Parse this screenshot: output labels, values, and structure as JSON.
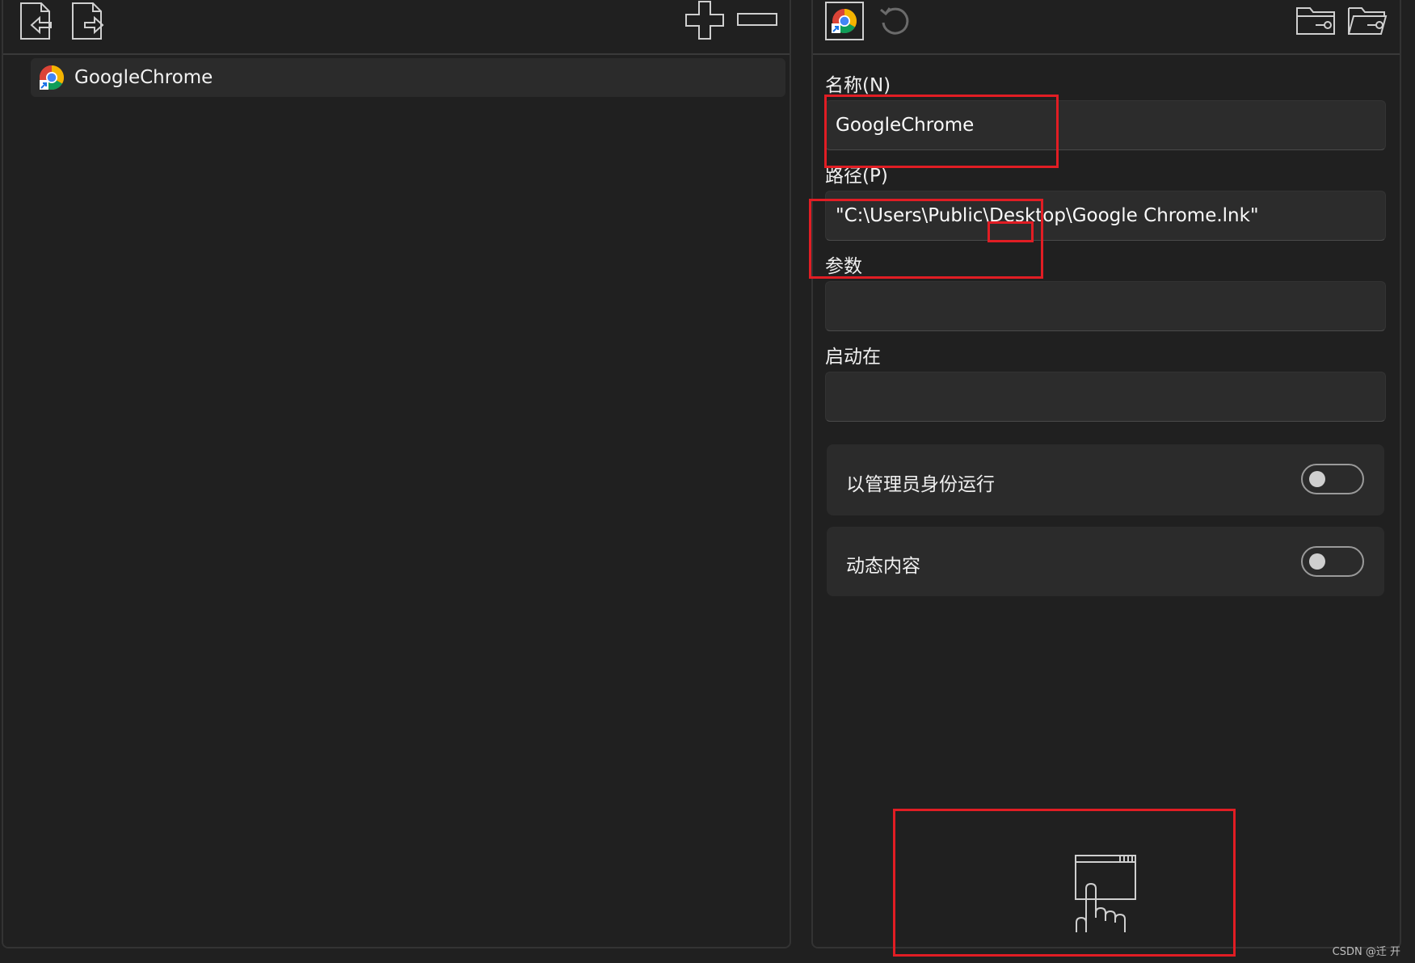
{
  "left_panel": {
    "items": [
      {
        "label": "GoogleChrome",
        "icon": "chrome-icon"
      }
    ]
  },
  "editor": {
    "name": {
      "label": "名称(N)",
      "value": "GoogleChrome"
    },
    "path": {
      "label": "路径(P)",
      "value": "\"C:\\Users\\Public\\Desktop\\Google Chrome.lnk\""
    },
    "args": {
      "label": "参数",
      "value": ""
    },
    "start_in": {
      "label": "启动在",
      "value": ""
    },
    "toggles": [
      {
        "label": "以管理员身份运行",
        "on": false
      },
      {
        "label": "动态内容",
        "on": false
      }
    ]
  },
  "watermark": "CSDN @迁 开",
  "colors": {
    "background": "#202020",
    "field": "#2c2c2c",
    "highlight": "#e11d24"
  }
}
